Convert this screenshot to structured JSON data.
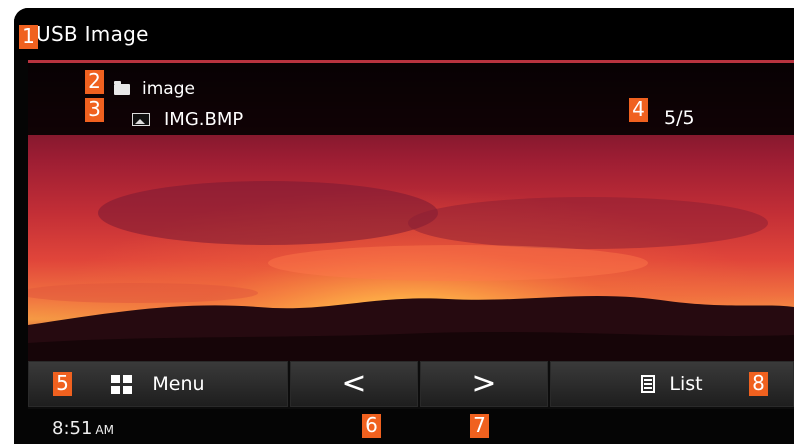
{
  "header": {
    "title": "USB Image"
  },
  "info": {
    "folder_name": "image",
    "file_name": "IMG.BMP",
    "position": "5/5"
  },
  "buttons": {
    "menu_label": "Menu",
    "prev_label": "<",
    "next_label": ">",
    "list_label": "List"
  },
  "status": {
    "time": "8:51",
    "ampm": "AM"
  },
  "callouts": [
    "1",
    "2",
    "3",
    "4",
    "5",
    "6",
    "7",
    "8"
  ],
  "colors": {
    "accent": "#b8333f",
    "callout": "#f0611f"
  }
}
